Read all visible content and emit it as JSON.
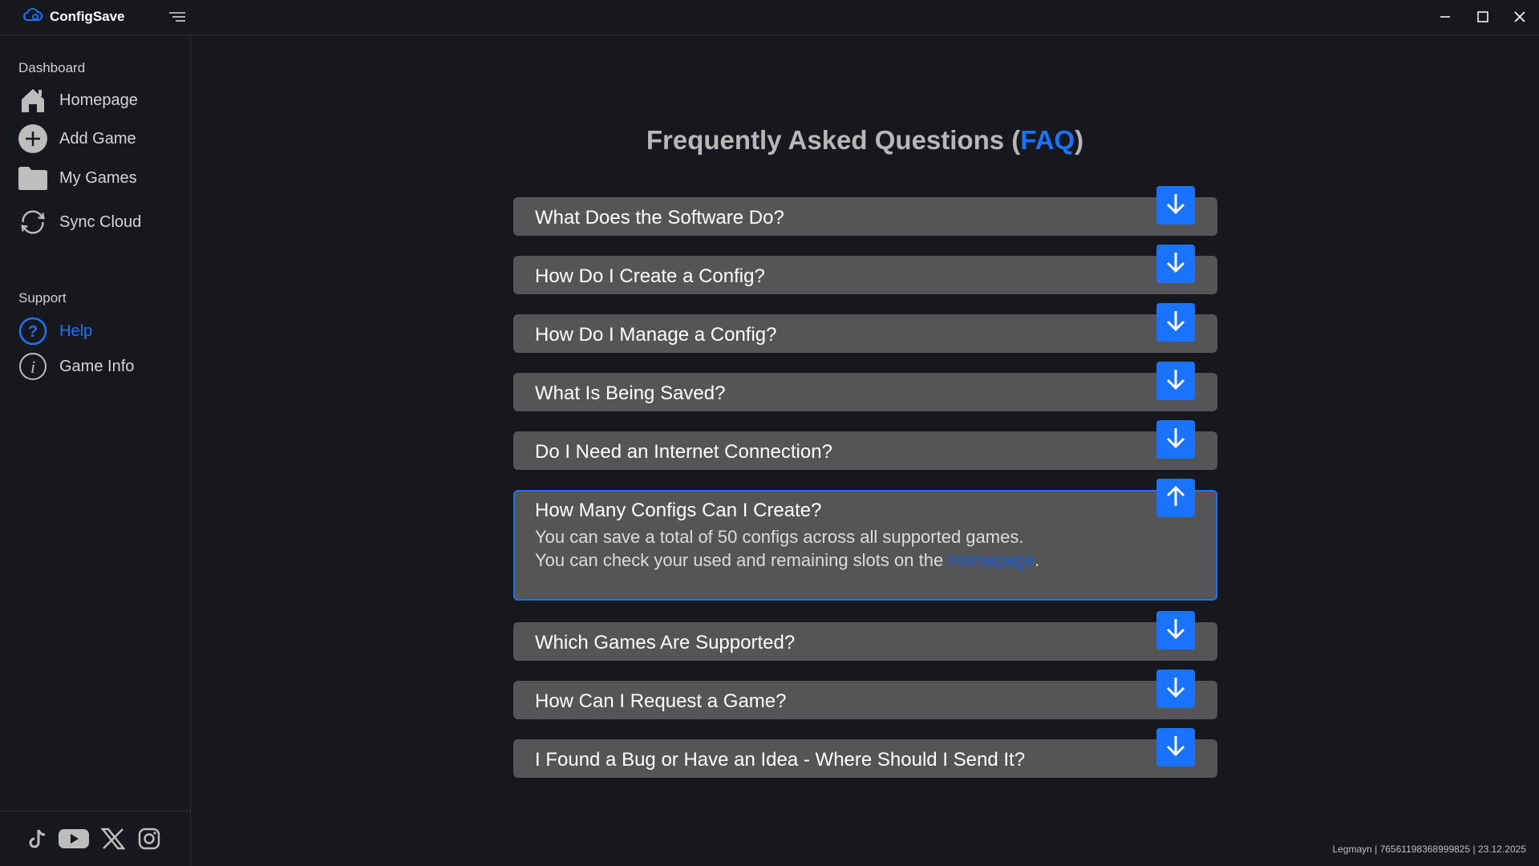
{
  "app": {
    "name": "ConfigSave"
  },
  "sidebar": {
    "sections": [
      {
        "label": "Dashboard"
      },
      {
        "label": "Support"
      }
    ],
    "dashboard_items": [
      {
        "label": "Homepage",
        "icon": "home-icon"
      },
      {
        "label": "Add Game",
        "icon": "plus-circle-icon"
      },
      {
        "label": "My Games",
        "icon": "folder-icon"
      },
      {
        "label": "Sync Cloud",
        "icon": "sync-icon"
      }
    ],
    "support_items": [
      {
        "label": "Help",
        "icon": "question-circle-icon",
        "active": true
      },
      {
        "label": "Game Info",
        "icon": "info-circle-icon"
      }
    ],
    "socials": [
      "tiktok-icon",
      "youtube-icon",
      "x-icon",
      "instagram-icon"
    ]
  },
  "faq": {
    "title_prefix": "Frequently Asked Questions (",
    "title_accent": "FAQ",
    "title_suffix": ")",
    "items": [
      {
        "question": "What Does the Software Do?",
        "expanded": false
      },
      {
        "question": "How Do I Create a Config?",
        "expanded": false
      },
      {
        "question": "How Do I Manage a Config?",
        "expanded": false
      },
      {
        "question": "What Is Being Saved?",
        "expanded": false
      },
      {
        "question": "Do I Need an Internet Connection?",
        "expanded": false
      },
      {
        "question": "How Many Configs Can I Create?",
        "expanded": true,
        "answer_line1": "You can save a total of 50 configs across all supported games.",
        "answer_line2_prefix": "You can check your used and remaining slots on the ",
        "answer_link": "Homepage",
        "answer_line2_suffix": "."
      },
      {
        "question": "Which Games Are Supported?",
        "expanded": false
      },
      {
        "question": "How Can I Request a Game?",
        "expanded": false
      },
      {
        "question": "I Found a Bug or Have an Idea - Where Should I Send It?",
        "expanded": false
      }
    ]
  },
  "footer": {
    "info": "Legmayn | 76561198368999825 | 23.12.2025"
  },
  "colors": {
    "accent": "#1a73ff",
    "background": "#17181d",
    "item": "#555558"
  }
}
